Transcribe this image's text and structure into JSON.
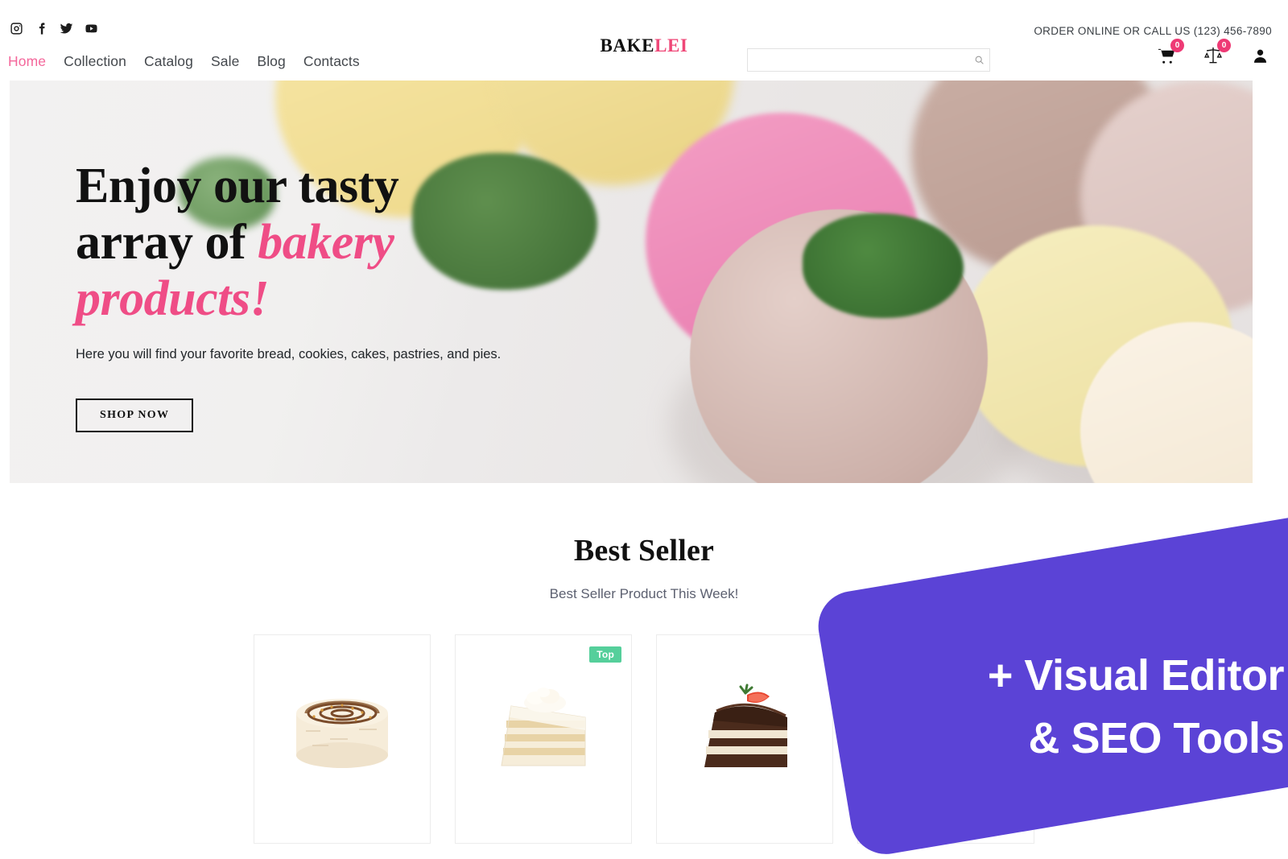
{
  "header": {
    "social": [
      {
        "name": "instagram-icon",
        "label": "Instagram"
      },
      {
        "name": "facebook-icon",
        "label": "Facebook"
      },
      {
        "name": "twitter-icon",
        "label": "Twitter"
      },
      {
        "name": "youtube-icon",
        "label": "YouTube"
      }
    ],
    "nav": [
      {
        "label": "Home",
        "active": true
      },
      {
        "label": "Collection",
        "active": false
      },
      {
        "label": "Catalog",
        "active": false
      },
      {
        "label": "Sale",
        "active": false
      },
      {
        "label": "Blog",
        "active": false
      },
      {
        "label": "Contacts",
        "active": false
      }
    ],
    "logo": {
      "part1": "BAKE",
      "part2": "LEI"
    },
    "search": {
      "value": "",
      "placeholder": ""
    },
    "contact_text": "ORDER ONLINE OR CALL US (123) 456-7890",
    "cart_count": "0",
    "compare_count": "0",
    "account_label": "Account"
  },
  "hero": {
    "title_line1": "Enjoy our tasty",
    "title_line2_plain": "array of ",
    "title_line2_accent": "bakery",
    "title_line3_accent": "products!",
    "subtitle": "Here you will find your favorite bread, cookies, cakes, pastries, and pies.",
    "cta_label": "SHOP NOW"
  },
  "best_seller": {
    "title": "Best Seller",
    "subtitle": "Best Seller Product This Week!",
    "products": [
      {
        "name": "caramel-swirl-cake",
        "badge": ""
      },
      {
        "name": "honey-layer-cake-slice",
        "badge": "Top"
      },
      {
        "name": "chocolate-strawberry-cake-slice",
        "badge": ""
      },
      {
        "name": "fourth-product",
        "badge": ""
      }
    ]
  },
  "promo": {
    "line1": "+ Visual Editor",
    "line2": "& SEO Tools"
  },
  "colors": {
    "accent_pink": "#ef4d86",
    "nav_active": "#f4679b",
    "badge_pink": "#ee3a75",
    "tag_green": "#55cf9b",
    "promo_purple": "#5b43d6"
  }
}
